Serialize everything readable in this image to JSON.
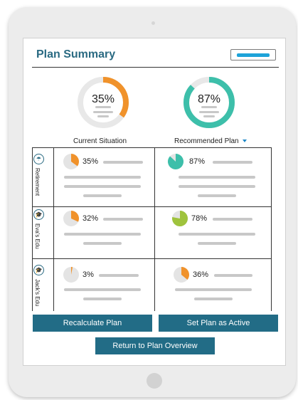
{
  "header": {
    "title": "Plan Summary"
  },
  "summary": {
    "current": {
      "percent": 35,
      "label": "35%",
      "title": "Current Situation",
      "color": "#f0922b"
    },
    "recommended": {
      "percent": 87,
      "label": "87%",
      "title": "Recommended Plan",
      "color": "#3dbfaa"
    }
  },
  "rows": [
    {
      "label": "Retirement",
      "icon": "umbrella-icon",
      "current": {
        "percent": 35,
        "label": "35%",
        "color": "#f0922b"
      },
      "recommended": {
        "percent": 87,
        "label": "87%",
        "color": "#3dbfaa"
      }
    },
    {
      "label": "Eva's Edu",
      "icon": "graduate-icon",
      "current": {
        "percent": 32,
        "label": "32%",
        "color": "#f0922b"
      },
      "recommended": {
        "percent": 78,
        "label": "78%",
        "color": "#9fc33d"
      }
    },
    {
      "label": "Jack's Edu",
      "icon": "graduate-icon",
      "current": {
        "percent": 3,
        "label": "3%",
        "color": "#f0922b"
      },
      "recommended": {
        "percent": 36,
        "label": "36%",
        "color": "#f0922b"
      }
    }
  ],
  "actions": {
    "recalculate": "Recalculate Plan",
    "set_active": "Set Plan as Active",
    "return": "Return to Plan Overview"
  },
  "colors": {
    "brand": "#226c86",
    "accent": "#1ea3d9",
    "placeholder": "#c8c8c8"
  }
}
